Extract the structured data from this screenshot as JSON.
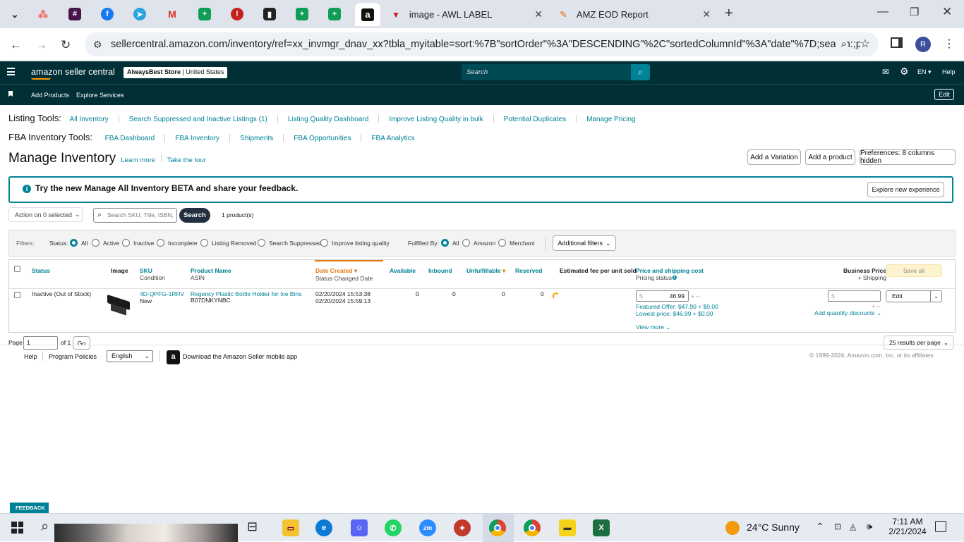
{
  "browser": {
    "tabs": [
      {
        "label": "image - AWL LABEL"
      },
      {
        "label": "AMZ EOD Report"
      }
    ],
    "url": "sellercentral.amazon.com/inventory/ref=xx_invmgr_dnav_xx?tbla_myitable=sort:%7B\"sortOrder\"%3A\"DESCENDING\"%2C\"sortedColumnId\"%3A\"date\"%7D;search:;p...",
    "profile_initial": "R"
  },
  "header": {
    "logo": "amazon seller central",
    "store": "AlwaysBest Store",
    "marketplace": "United States",
    "search_placeholder": "Search",
    "lang": "EN",
    "help": "Help"
  },
  "subnav": {
    "add_products": "Add Products",
    "explore_services": "Explore Services",
    "edit": "Edit"
  },
  "listing_tools": {
    "label": "Listing Tools:",
    "links": [
      "All Inventory",
      "Search Suppressed and Inactive Listings (1)",
      "Listing Quality Dashboard",
      "Improve Listing Quality in bulk",
      "Potential Duplicates",
      "Manage Pricing"
    ]
  },
  "fba_tools": {
    "label": "FBA Inventory Tools:",
    "links": [
      "FBA Dashboard",
      "FBA Inventory",
      "Shipments",
      "FBA Opportunities",
      "FBA Analytics"
    ]
  },
  "page": {
    "title": "Manage Inventory",
    "learn_more": "Learn more",
    "take_tour": "Take the tour",
    "add_variation": "Add a Variation",
    "add_product": "Add a product",
    "preferences": "Preferences: 8 columns hidden"
  },
  "banner": {
    "text": "Try the new Manage All Inventory BETA and share your feedback.",
    "button": "Explore new experience"
  },
  "actions": {
    "action_select": "Action on 0 selected",
    "search_placeholder": "Search SKU, Title, ISBN,",
    "search_button": "Search",
    "count": "1 product(s)"
  },
  "filters": {
    "label": "Filters:",
    "status_label": "Status:",
    "status_options": [
      "All",
      "Active",
      "Inactive",
      "Incomplete",
      "Listing Removed",
      "Search Suppressed",
      "Improve listing quality"
    ],
    "fulfilled_label": "Fulfilled By:",
    "fulfilled_options": [
      "All",
      "Amazon",
      "Merchant"
    ],
    "additional": "Additional filters"
  },
  "table": {
    "headers": {
      "status": "Status",
      "image": "Image",
      "sku": "SKU",
      "sku_sub": "Condition",
      "product": "Product Name",
      "product_sub": "ASIN",
      "date": "Date Created",
      "date_sub": "Status Changed Date",
      "available": "Available",
      "inbound": "Inbound",
      "unfulfillable": "Unfulfillable",
      "reserved": "Reserved",
      "fee": "Estimated fee per unit sold",
      "price": "Price and shipping cost",
      "price_sub": "Pricing status",
      "business": "Business Price",
      "business_sub": "+ Shipping",
      "save_all": "Save all"
    },
    "row": {
      "status": "Inactive (Out of Stock)",
      "sku": "4D-QPFG-1RRV",
      "condition": "New",
      "product": "Regency Plastic Bottle Holder for Ice Bins",
      "asin": "B07DNKYNBC",
      "date_created": "02/20/2024 15:53:38",
      "date_changed": "02/20/2024 15:59:13",
      "available": "0",
      "inbound": "0",
      "unfulfillable": "0",
      "reserved": "0",
      "price": "46.99",
      "currency": "$",
      "featured": "Featured Offer: $47.90 + $0.00",
      "lowest": "Lowest price: $46.99 + $0.00",
      "view_more": "View more",
      "add_qty": "Add quantity discounts",
      "edit": "Edit"
    }
  },
  "pager": {
    "page_label": "Page",
    "page": "1",
    "of": "of 1",
    "go": "Go",
    "per_page": "25 results per page"
  },
  "footer": {
    "help": "Help",
    "policies": "Program Policies",
    "language": "English",
    "app": "Download the Amazon Seller mobile app",
    "copyright": "© 1999-2024, Amazon.com, Inc. or its affiliates",
    "feedback": "FEEDBACK"
  },
  "taskbar": {
    "weather": "24°C  Sunny",
    "time": "7:11 AM",
    "date": "2/21/2024"
  }
}
